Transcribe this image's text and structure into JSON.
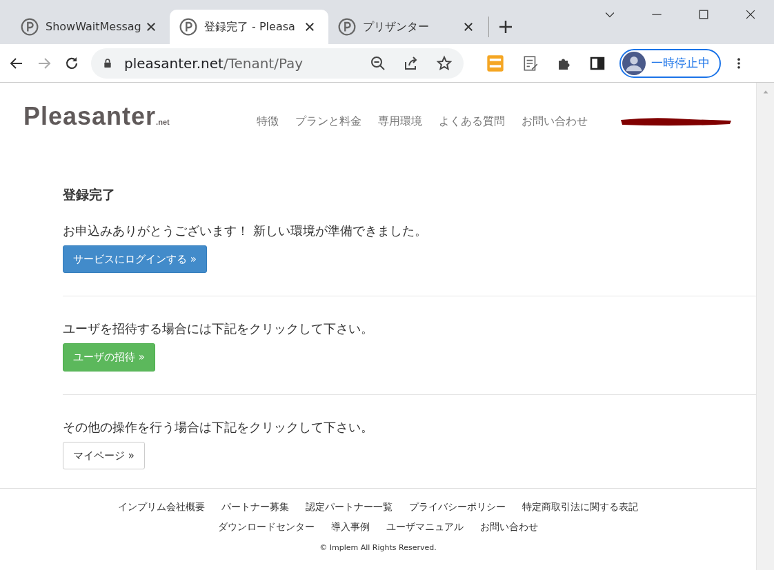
{
  "browser": {
    "tabs": [
      {
        "title": "ShowWaitMessag",
        "selected": false
      },
      {
        "title": "登録完了 - Pleasa",
        "selected": true
      },
      {
        "title": "プリザンター",
        "selected": false
      }
    ],
    "address": {
      "host": "pleasanter.net",
      "path": "/Tenant/Pay"
    },
    "profile_label": "一時停止中"
  },
  "header": {
    "logo": "Pleasanter",
    "logo_suffix": ".net",
    "nav": [
      "特徴",
      "プランと料金",
      "専用環境",
      "よくある質問",
      "お問い合わせ"
    ]
  },
  "main": {
    "title": "登録完了",
    "sections": [
      {
        "text": "お申込みありがとうございます！ 新しい環境が準備できました。",
        "button": "サービスにログインする »",
        "kind": "primary"
      },
      {
        "text": "ユーザを招待する場合には下記をクリックして下さい。",
        "button": "ユーザの招待 »",
        "kind": "success"
      },
      {
        "text": "その他の操作を行う場合は下記をクリックして下さい。",
        "button": "マイページ »",
        "kind": "default"
      }
    ]
  },
  "footer": {
    "link_rows": [
      [
        "インプリム会社概要",
        "パートナー募集",
        "認定パートナー一覧",
        "プライバシーポリシー",
        "特定商取引法に関する表記"
      ],
      [
        "ダウンロードセンター",
        "導入事例",
        "ユーザマニュアル",
        "お問い合わせ"
      ]
    ],
    "copyright": "© Implem All Rights Reserved."
  }
}
